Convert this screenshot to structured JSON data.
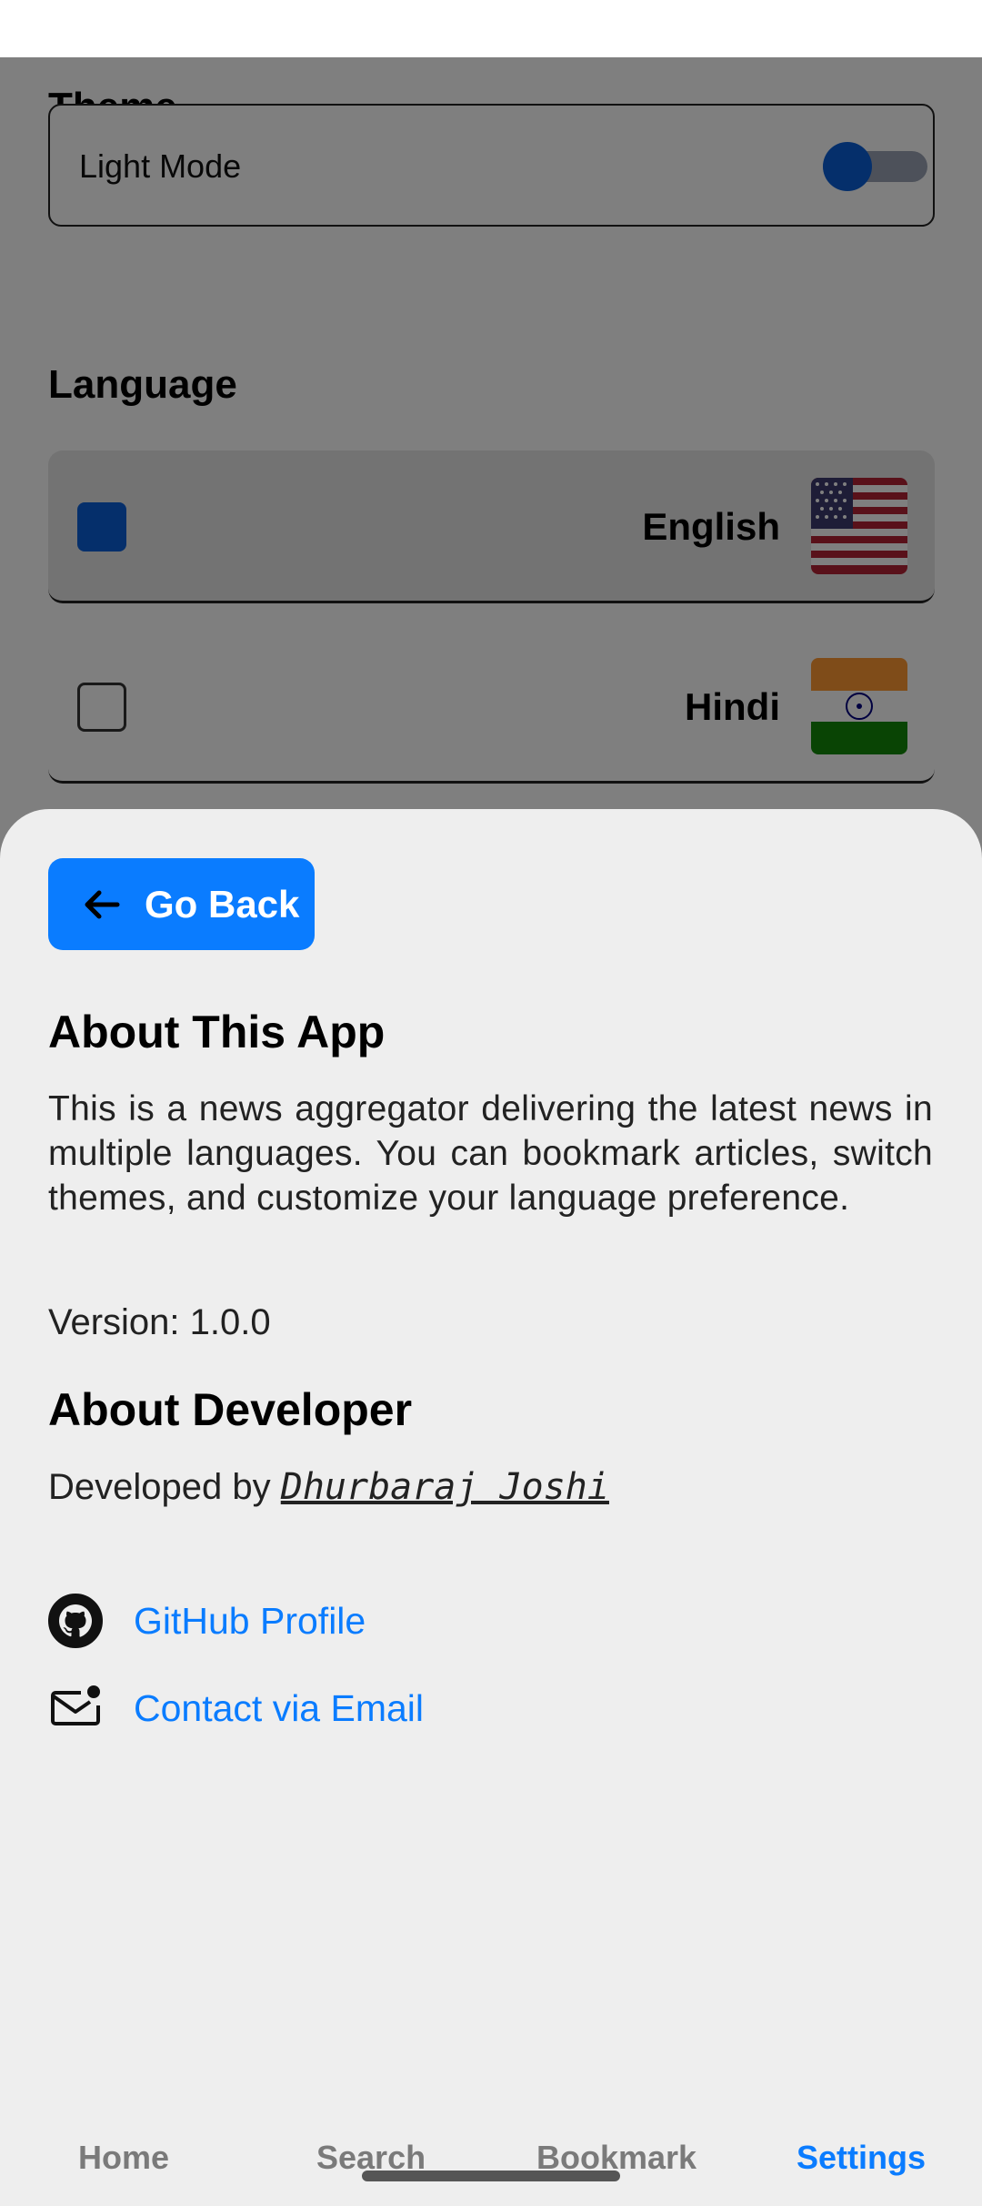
{
  "settings": {
    "theme": {
      "title": "Theme",
      "mode_label": "Light Mode",
      "toggle_on": false
    },
    "language": {
      "title": "Language",
      "options": [
        {
          "name": "English",
          "selected": true,
          "flag": "us-flag-icon"
        },
        {
          "name": "Hindi",
          "selected": false,
          "flag": "india-flag-icon"
        }
      ]
    }
  },
  "sheet": {
    "back_button": {
      "label": "Go Back",
      "icon": "arrow-left-icon"
    },
    "about_app": {
      "title": "About This App",
      "description": "This is a news aggregator delivering the latest news in multiple languages. You can bookmark articles, switch themes, and customize your language preference.",
      "version": "Version: 1.0.0"
    },
    "about_developer": {
      "title": "About Developer",
      "developed_by": "Developed by",
      "developer_name": "Dhurbaraj Joshi"
    },
    "links": [
      {
        "label": "GitHub Profile",
        "icon": "github-icon"
      },
      {
        "label": "Contact via Email",
        "icon": "email-icon"
      }
    ]
  },
  "tabbar": {
    "tabs": [
      {
        "label": "Home",
        "active": false
      },
      {
        "label": "Search",
        "active": false
      },
      {
        "label": "Bookmark",
        "active": false
      },
      {
        "label": "Settings",
        "active": true
      }
    ]
  },
  "colors": {
    "accent": "#0a7cff",
    "checkbox_selected": "#0a5fd6",
    "sheet_background": "#eeeeee"
  }
}
